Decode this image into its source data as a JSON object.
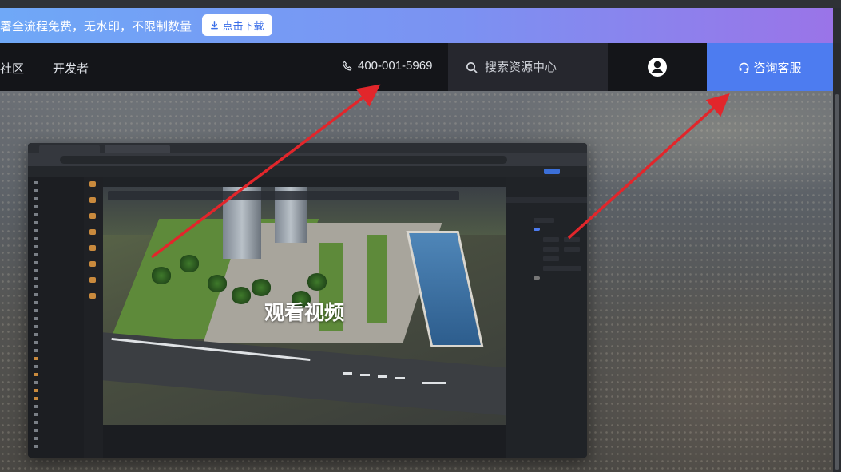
{
  "banner": {
    "text": "署全流程免费，无水印，不限制数量",
    "download_label": "点击下载"
  },
  "nav": {
    "items": [
      "社区",
      "开发者"
    ],
    "phone": "400-001-5969",
    "search_placeholder": "搜索资源中心",
    "support_label": "咨询客服"
  },
  "video": {
    "label": "观看视频"
  },
  "colors": {
    "banner_start": "#6fa8f7",
    "banner_end": "#9a74e8",
    "nav_bg": "#141519",
    "support_bg": "#4d7cf0",
    "arrow": "#e2262b"
  }
}
